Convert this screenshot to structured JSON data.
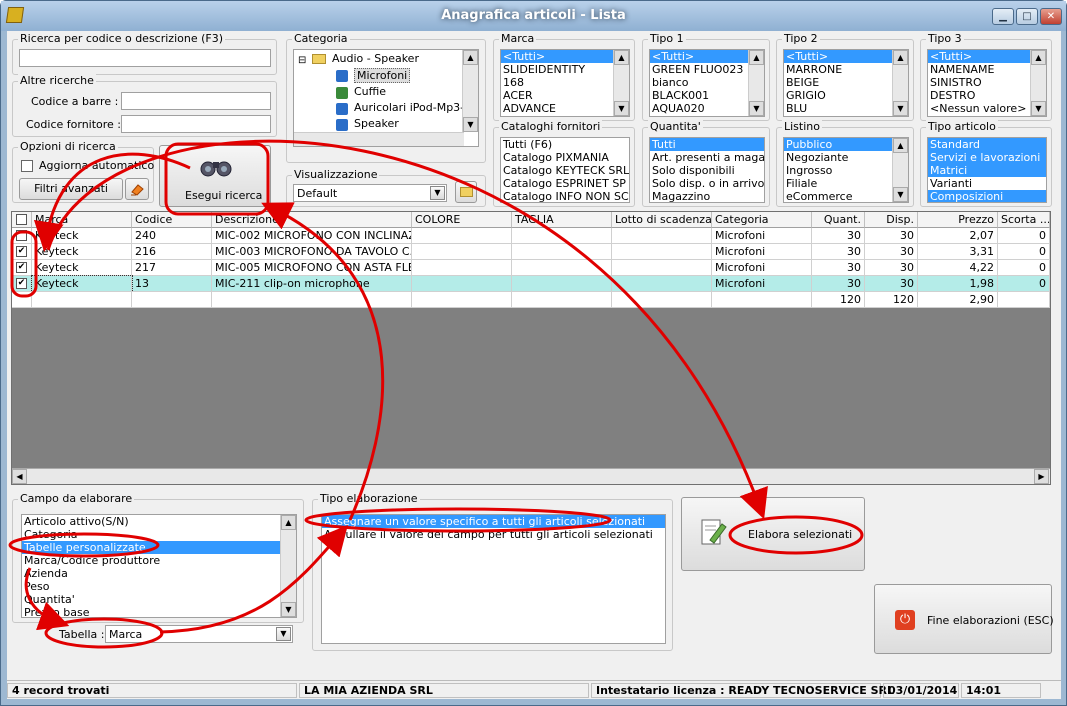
{
  "window": {
    "title": "Anagrafica articoli  - Lista",
    "min": "▁",
    "max": "□",
    "close": "✕"
  },
  "search": {
    "group_label": "Ricerca per codice o descrizione (F3)",
    "value": "",
    "other_label": "Altre ricerche",
    "barcode_label": "Codice a barre :",
    "supplier_code_label": "Codice fornitore :",
    "options_label": "Opzioni di ricerca",
    "auto_update_label": "Aggiorna automatico",
    "auto_update_checked": false,
    "adv_filters_label": "Filtri avanzati",
    "run_label": "Esegui ricerca"
  },
  "categoria": {
    "label": "Categoria",
    "tree": [
      "Audio - Speaker",
      "Microfoni",
      "Cuffie",
      "Auricolari iPod-Mp3-Mp4",
      "Speaker"
    ],
    "selected": "Microfoni"
  },
  "visualizzazione": {
    "label": "Visualizzazione",
    "value": "Default"
  },
  "filters": {
    "marca": {
      "label": "Marca",
      "items": [
        "<Tutti>",
        "SLIDEIDENTITY",
        "168",
        "ACER",
        "ADVANCE"
      ],
      "selected": [
        0
      ]
    },
    "tipo1": {
      "label": "Tipo 1",
      "items": [
        "<Tutti>",
        "GREEN FLUO023",
        "bianco",
        "BLACK001",
        "AQUA020"
      ],
      "selected": [
        0
      ]
    },
    "tipo2": {
      "label": "Tipo 2",
      "items": [
        "<Tutti>",
        "MARRONE",
        "BEIGE",
        "GRIGIO",
        "BLU"
      ],
      "selected": [
        0
      ]
    },
    "tipo3": {
      "label": "Tipo 3",
      "items": [
        "<Tutti>",
        "NAMENAME",
        "SINISTRO",
        "DESTRO",
        "<Nessun valore>"
      ],
      "selected": [
        0
      ]
    },
    "cataloghi": {
      "label": "Cataloghi fornitori",
      "items": [
        "Tutti (F6)",
        "Catalogo PIXMANIA",
        "Catalogo KEYTECK SRL",
        "Catalogo ESPRINET SP",
        "Catalogo INFO NON SC"
      ],
      "selected": []
    },
    "quantita": {
      "label": "Quantita'",
      "items": [
        "Tutti",
        "Art. presenti a maga",
        "Solo disponibili",
        "Solo disp. o in arrivo",
        "Magazzino"
      ],
      "selected": [
        0
      ]
    },
    "listino": {
      "label": "Listino",
      "items": [
        "Pubblico",
        "Negoziante",
        "Ingrosso",
        "Filiale",
        "eCommerce"
      ],
      "selected": [
        0
      ]
    },
    "tipo_articolo": {
      "label": "Tipo articolo",
      "items": [
        "Standard",
        "Servizi e lavorazioni",
        "Matrici",
        "Varianti",
        "Composizioni"
      ],
      "selected": [
        0,
        1,
        2,
        4
      ]
    }
  },
  "grid": {
    "columns": [
      "Marca",
      "Codice",
      "Descrizione",
      "COLORE",
      "TAGLIA",
      "Lotto di scadenza",
      "Categoria",
      "Quant.",
      "Disp.",
      "Prezzo",
      "Scorta ..."
    ],
    "rows": [
      {
        "checked": false,
        "marca": "Keyteck",
        "codice": "240",
        "descrizione": "MIC-002 MICROFONO CON INCLINAZ...",
        "colore": "",
        "taglia": "",
        "lotto": "",
        "categoria": "Microfoni",
        "quant": "30",
        "disp": "30",
        "prezzo": "2,07",
        "scorta": "0"
      },
      {
        "checked": true,
        "marca": "Keyteck",
        "codice": "216",
        "descrizione": "MIC-003 MICROFONO DA TAVOLO C...",
        "colore": "",
        "taglia": "",
        "lotto": "",
        "categoria": "Microfoni",
        "quant": "30",
        "disp": "30",
        "prezzo": "3,31",
        "scorta": "0"
      },
      {
        "checked": true,
        "marca": "Keyteck",
        "codice": "217",
        "descrizione": "MIC-005 MICROFONO CON ASTA FLE...",
        "colore": "",
        "taglia": "",
        "lotto": "",
        "categoria": "Microfoni",
        "quant": "30",
        "disp": "30",
        "prezzo": "4,22",
        "scorta": "0"
      },
      {
        "checked": true,
        "marca": "Keyteck",
        "codice": "13",
        "descrizione": "MIC-211 clip-on microphone",
        "colore": "",
        "taglia": "",
        "lotto": "",
        "categoria": "Microfoni",
        "quant": "30",
        "disp": "30",
        "prezzo": "1,98",
        "scorta": "0"
      }
    ],
    "totals": {
      "quant": "120",
      "disp": "120",
      "prezzo": "2,90"
    }
  },
  "campo": {
    "label": "Campo da elaborare",
    "items": [
      "Articolo attivo(S/N)",
      "Categoria",
      "Tabelle personalizzate",
      "Marca/Codice produttore",
      "Azienda",
      "Peso",
      "Quantita'",
      "Prezzo base"
    ],
    "selected": 2,
    "tabella_label": "Tabella :",
    "tabella_value": "Marca"
  },
  "tipo_elaborazione": {
    "label": "Tipo elaborazione",
    "items": [
      "Assegnare un valore specifico a tutti gli articoli selezionati",
      "Annullare il valore del campo per tutti gli articoli selezionati"
    ],
    "selected": 0
  },
  "actions": {
    "elabora_label": "Elabora selezionati",
    "fine_label": "Fine elaborazioni (ESC)"
  },
  "status": {
    "records": "4 record trovati",
    "company": "LA MIA AZIENDA SRL",
    "license": "Intestatario licenza : READY TECNOSERVICE SRL",
    "date": "03/01/2014",
    "time": "14:01"
  },
  "colors": {
    "selection": "#3399ff",
    "annotation": "#e00000",
    "highlight_row": "#b4ece8"
  }
}
